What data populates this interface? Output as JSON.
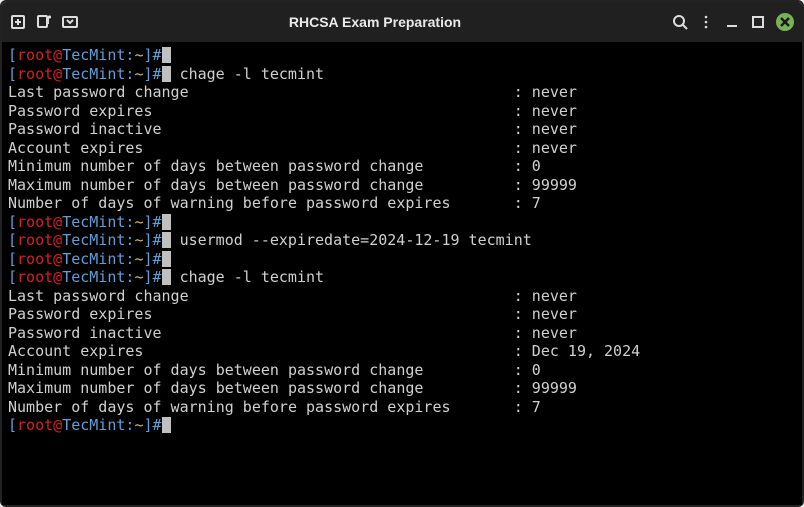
{
  "window": {
    "title": "RHCSA Exam Preparation"
  },
  "prompt": {
    "open": "[",
    "user": "root",
    "at": "@",
    "host": "TecMint",
    "sep": ":",
    "path": "~",
    "close": "]",
    "hash": "#"
  },
  "session": {
    "cmd1": "chage -l tecmint",
    "cmd2": "usermod --expiredate=2024-12-19 tecmint",
    "cmd3": "chage -l tecmint",
    "out1": [
      {
        "label": "Last password change",
        "value": "never"
      },
      {
        "label": "Password expires",
        "value": "never"
      },
      {
        "label": "Password inactive",
        "value": "never"
      },
      {
        "label": "Account expires",
        "value": "never"
      },
      {
        "label": "Minimum number of days between password change",
        "value": "0"
      },
      {
        "label": "Maximum number of days between password change",
        "value": "99999"
      },
      {
        "label": "Number of days of warning before password expires",
        "value": "7"
      }
    ],
    "out2": [
      {
        "label": "Last password change",
        "value": "never"
      },
      {
        "label": "Password expires",
        "value": "never"
      },
      {
        "label": "Password inactive",
        "value": "never"
      },
      {
        "label": "Account expires",
        "value": "Dec 19, 2024"
      },
      {
        "label": "Minimum number of days between password change",
        "value": "0"
      },
      {
        "label": "Maximum number of days between password change",
        "value": "99999"
      },
      {
        "label": "Number of days of warning before password expires",
        "value": "7"
      }
    ]
  }
}
